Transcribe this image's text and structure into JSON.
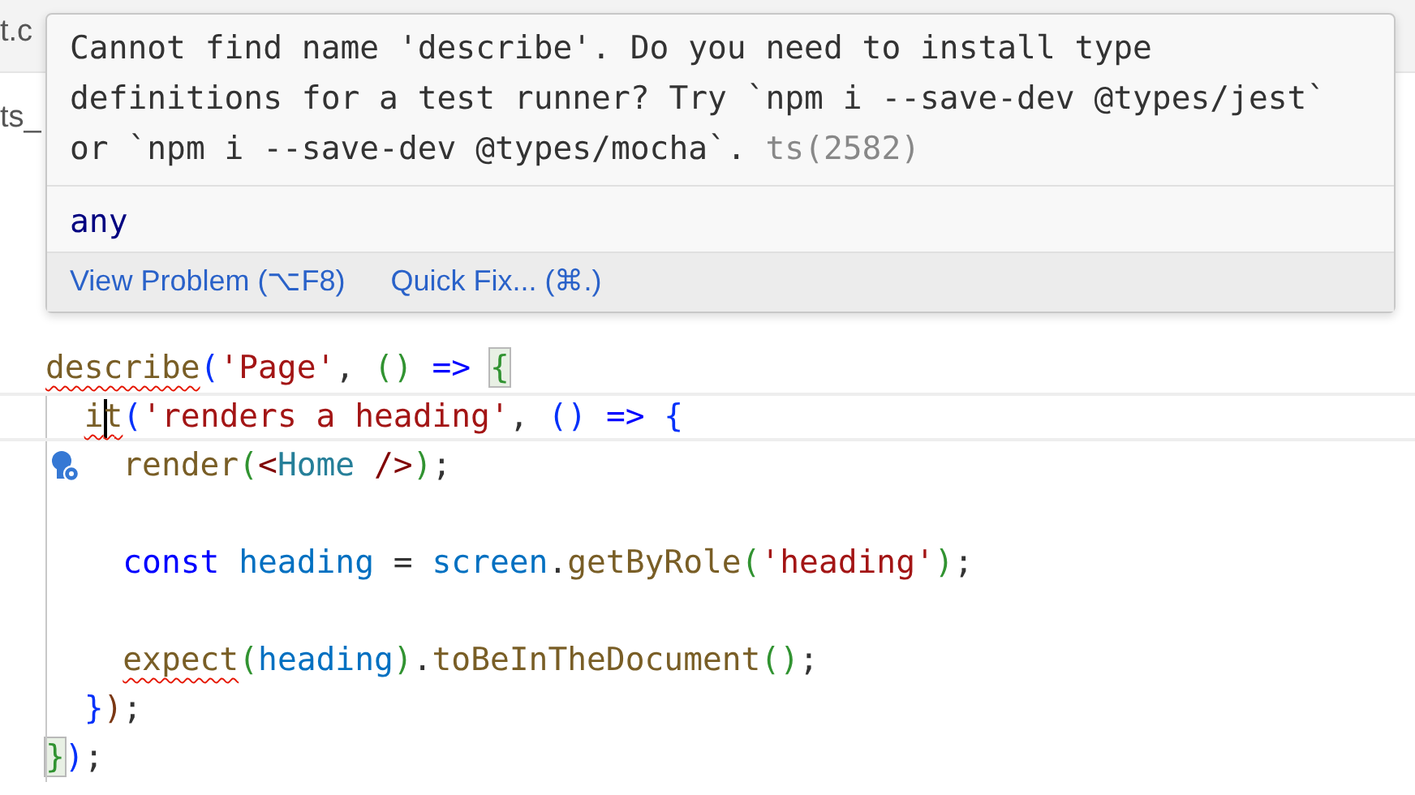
{
  "tab_bar": {
    "tab_fragment": "t.c"
  },
  "breadcrumb": {
    "fragment": "ts_"
  },
  "hover": {
    "message": "Cannot find name 'describe'. Do you need to install type definitions for a test runner? Try `npm i --save-dev @types/jest` or `npm i --save-dev @types/mocha`.",
    "source": "ts(2582)",
    "type": "any",
    "actions": [
      "View Problem (⌥F8)",
      "Quick Fix... (⌘.)"
    ]
  },
  "code_lines": [
    {
      "current": false,
      "lightbulb": false,
      "tokens": [
        {
          "text": "describe",
          "kind": "function",
          "squiggle": true
        },
        {
          "text": "(",
          "kind": "bracket1"
        },
        {
          "text": "'Page'",
          "kind": "string"
        },
        {
          "text": ", ",
          "kind": "punct"
        },
        {
          "text": "() ",
          "kind": "bracket2"
        },
        {
          "text": "=> ",
          "kind": "keyword"
        },
        {
          "text": "{",
          "kind": "bracket2",
          "matched": true
        }
      ]
    },
    {
      "current": true,
      "lightbulb": false,
      "tokens": [
        {
          "text": "  i",
          "kind": "function",
          "squiggle": true,
          "cursor_after": true
        },
        {
          "text": "t",
          "kind": "function",
          "squiggle": true
        },
        {
          "text": "(",
          "kind": "bracket1"
        },
        {
          "text": "'renders a heading'",
          "kind": "string"
        },
        {
          "text": ", ",
          "kind": "punct"
        },
        {
          "text": "() ",
          "kind": "bracket1"
        },
        {
          "text": "=> ",
          "kind": "keyword"
        },
        {
          "text": "{",
          "kind": "bracket1"
        }
      ]
    },
    {
      "current": false,
      "lightbulb": true,
      "tokens": [
        {
          "text": "    render",
          "kind": "function"
        },
        {
          "text": "(",
          "kind": "bracket2"
        },
        {
          "text": "<",
          "kind": "tag"
        },
        {
          "text": "Home",
          "kind": "type"
        },
        {
          "text": " />",
          "kind": "tag"
        },
        {
          "text": ")",
          "kind": "bracket2"
        },
        {
          "text": ";",
          "kind": "punct"
        }
      ]
    },
    {
      "current": false,
      "lightbulb": false
    },
    {
      "current": false,
      "lightbulb": false,
      "tokens": [
        {
          "text": "    const ",
          "kind": "keyword"
        },
        {
          "text": "heading",
          "kind": "variable"
        },
        {
          "text": " = ",
          "kind": "punct"
        },
        {
          "text": "screen",
          "kind": "variable"
        },
        {
          "text": ".",
          "kind": "punct"
        },
        {
          "text": "getByRole",
          "kind": "function"
        },
        {
          "text": "(",
          "kind": "bracket2"
        },
        {
          "text": "'heading'",
          "kind": "string"
        },
        {
          "text": ")",
          "kind": "bracket2"
        },
        {
          "text": ";",
          "kind": "punct"
        }
      ]
    },
    {
      "current": false,
      "lightbulb": false
    },
    {
      "current": false,
      "lightbulb": false,
      "tokens": [
        {
          "text": "    expect",
          "kind": "function",
          "squiggle": true
        },
        {
          "text": "(",
          "kind": "bracket2"
        },
        {
          "text": "heading",
          "kind": "variable"
        },
        {
          "text": ")",
          "kind": "bracket2"
        },
        {
          "text": ".",
          "kind": "punct"
        },
        {
          "text": "toBeInTheDocument",
          "kind": "function"
        },
        {
          "text": "()",
          "kind": "bracket2"
        },
        {
          "text": ";",
          "kind": "punct"
        }
      ]
    },
    {
      "current": false,
      "lightbulb": false,
      "tokens": [
        {
          "text": "  }",
          "kind": "bracket1"
        },
        {
          "text": ")",
          "kind": "bracket3"
        },
        {
          "text": ";",
          "kind": "punct"
        }
      ]
    },
    {
      "current": false,
      "lightbulb": false,
      "tokens": [
        {
          "text": "}",
          "kind": "bracket2",
          "matched": true
        },
        {
          "text": ")",
          "kind": "bracket1"
        },
        {
          "text": ";",
          "kind": "punct"
        }
      ]
    }
  ]
}
